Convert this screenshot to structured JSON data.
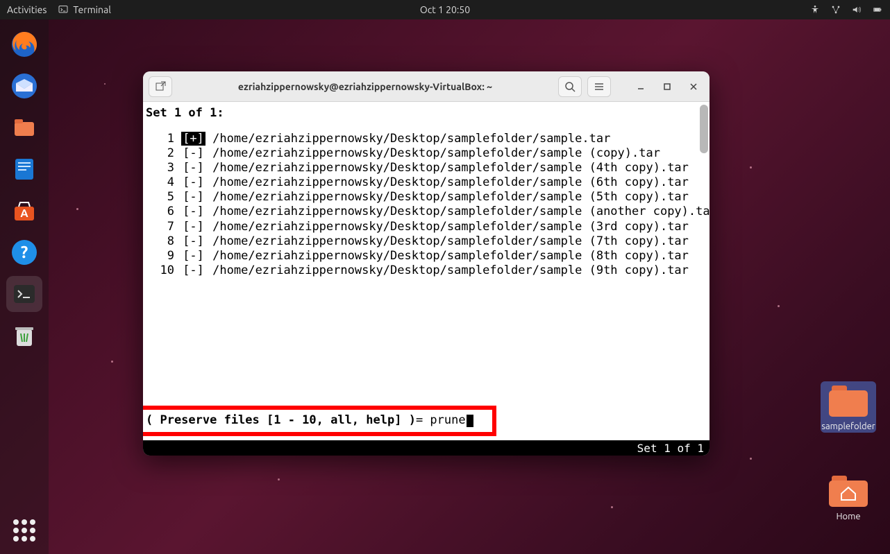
{
  "topbar": {
    "activities": "Activities",
    "app_name": "Terminal",
    "clock": "Oct 1  20:50"
  },
  "dock": {
    "items": [
      {
        "name": "firefox"
      },
      {
        "name": "thunderbird"
      },
      {
        "name": "files"
      },
      {
        "name": "writer"
      },
      {
        "name": "software"
      },
      {
        "name": "help"
      },
      {
        "name": "terminal"
      },
      {
        "name": "trash"
      }
    ]
  },
  "desktop": {
    "samplefolder": "samplefolder",
    "home": "Home"
  },
  "window": {
    "title": "ezriahzippernowsky@ezriahzippernowsky-VirtualBox: ~"
  },
  "terminal": {
    "set_header": "Set 1 of 1:",
    "files": [
      {
        "n": "1",
        "mark": "[+]",
        "selected": true,
        "path": "/home/ezriahzippernowsky/Desktop/samplefolder/sample.tar"
      },
      {
        "n": "2",
        "mark": "[-]",
        "selected": false,
        "path": "/home/ezriahzippernowsky/Desktop/samplefolder/sample (copy).tar"
      },
      {
        "n": "3",
        "mark": "[-]",
        "selected": false,
        "path": "/home/ezriahzippernowsky/Desktop/samplefolder/sample (4th copy).tar"
      },
      {
        "n": "4",
        "mark": "[-]",
        "selected": false,
        "path": "/home/ezriahzippernowsky/Desktop/samplefolder/sample (6th copy).tar"
      },
      {
        "n": "5",
        "mark": "[-]",
        "selected": false,
        "path": "/home/ezriahzippernowsky/Desktop/samplefolder/sample (5th copy).tar"
      },
      {
        "n": "6",
        "mark": "[-]",
        "selected": false,
        "path": "/home/ezriahzippernowsky/Desktop/samplefolder/sample (another copy).tar"
      },
      {
        "n": "7",
        "mark": "[-]",
        "selected": false,
        "path": "/home/ezriahzippernowsky/Desktop/samplefolder/sample (3rd copy).tar"
      },
      {
        "n": "8",
        "mark": "[-]",
        "selected": false,
        "path": "/home/ezriahzippernowsky/Desktop/samplefolder/sample (7th copy).tar"
      },
      {
        "n": "9",
        "mark": "[-]",
        "selected": false,
        "path": "/home/ezriahzippernowsky/Desktop/samplefolder/sample (8th copy).tar"
      },
      {
        "n": "10",
        "mark": "[-]",
        "selected": false,
        "path": "/home/ezriahzippernowsky/Desktop/samplefolder/sample (9th copy).tar"
      }
    ],
    "prompt_label": "( Preserve files [1 - 10, all, help] )",
    "prompt_sep": "= ",
    "prompt_input": "prune",
    "status": "Set 1 of 1"
  }
}
